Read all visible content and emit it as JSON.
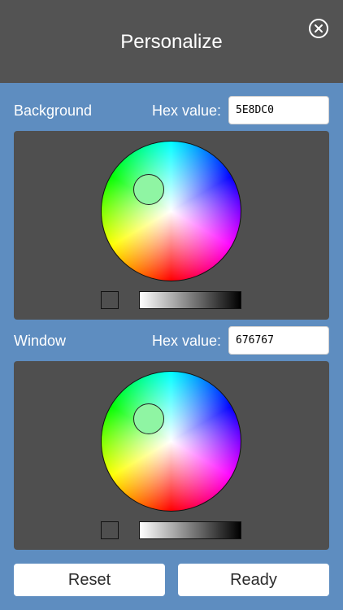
{
  "header": {
    "title": "Personalize",
    "close_icon": "close-circle-x-icon"
  },
  "background_section": {
    "label": "Background",
    "hex_label": "Hex value:",
    "hex_value": "5E8DC0"
  },
  "window_section": {
    "label": "Window",
    "hex_label": "Hex value:",
    "hex_value": "676767"
  },
  "buttons": {
    "reset_label": "Reset",
    "ready_label": "Ready"
  },
  "colors": {
    "background": "#5E8DC0",
    "window": "#676767",
    "header": "#535353"
  }
}
